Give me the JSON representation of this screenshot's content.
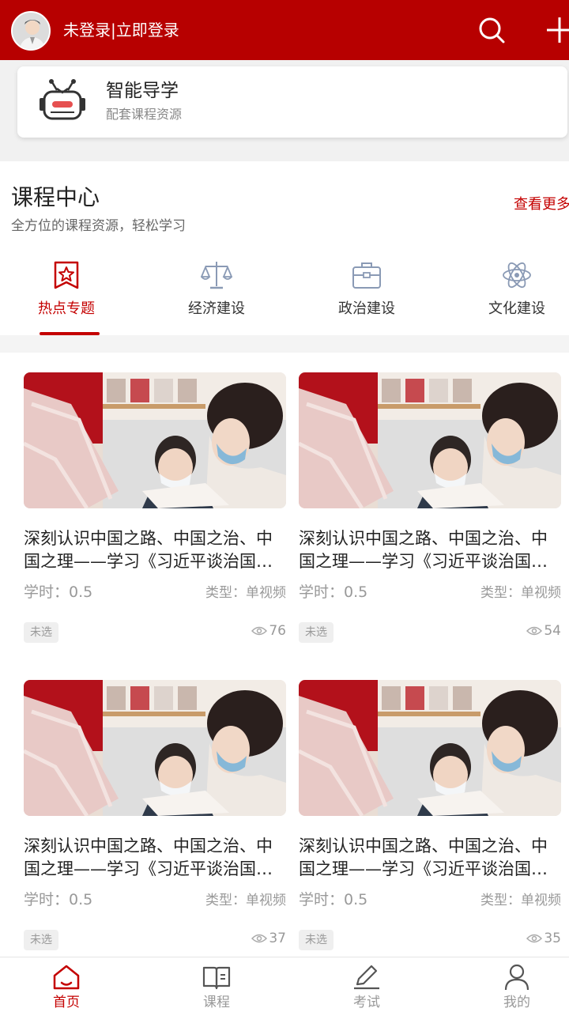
{
  "header": {
    "login_text": "未登录|立即登录"
  },
  "smart_card": {
    "title": "智能导学",
    "subtitle": "配套课程资源"
  },
  "course_center": {
    "title": "课程中心",
    "subtitle": "全方位的课程资源，轻松学习",
    "more_label": "查看更多"
  },
  "categories": [
    {
      "label": "热点专题",
      "icon": "flag-star-icon",
      "active": true
    },
    {
      "label": "经济建设",
      "icon": "scales-icon",
      "active": false
    },
    {
      "label": "政治建设",
      "icon": "briefcase-icon",
      "active": false
    },
    {
      "label": "文化建设",
      "icon": "atom-icon",
      "active": false
    }
  ],
  "courses": [
    {
      "title": "深刻认识中国之路、中国之治、中国之理——学习《习近平谈治国理政》",
      "hours": "学时：0.5",
      "type": "类型：单视频",
      "badge": "未选",
      "views": "76"
    },
    {
      "title": "深刻认识中国之路、中国之治、中国之理——学习《习近平谈治国理政》",
      "hours": "学时：0.5",
      "type": "类型：单视频",
      "badge": "未选",
      "views": "54"
    },
    {
      "title": "深刻认识中国之路、中国之治、中国之理——学习《习近平谈治国理政》",
      "hours": "学时：0.5",
      "type": "类型：单视频",
      "badge": "未选",
      "views": "37"
    },
    {
      "title": "深刻认识中国之路、中国之治、中国之理——学习《习近平谈治国理政》",
      "hours": "学时：0.5",
      "type": "类型：单视频",
      "badge": "未选",
      "views": "35"
    }
  ],
  "tabbar": [
    {
      "label": "首页",
      "icon": "home-icon",
      "active": true
    },
    {
      "label": "课程",
      "icon": "book-icon",
      "active": false
    },
    {
      "label": "考试",
      "icon": "pen-icon",
      "active": false
    },
    {
      "label": "我的",
      "icon": "user-icon",
      "active": false
    }
  ],
  "colors": {
    "brand": "#b70000",
    "accent": "#c40000"
  }
}
